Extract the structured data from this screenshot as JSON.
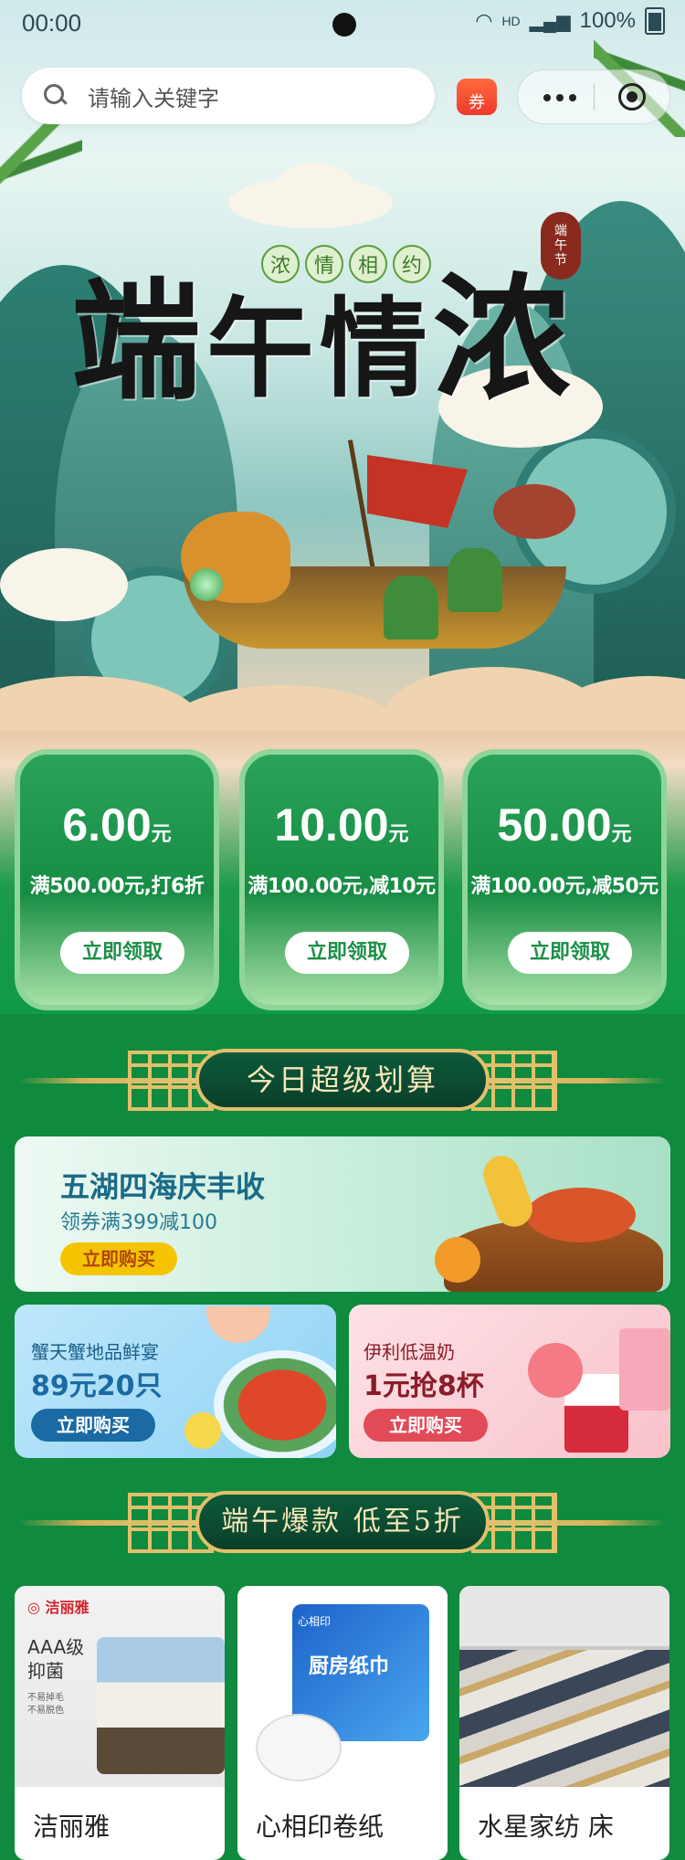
{
  "status_bar": {
    "time": "00:00",
    "network": "HD",
    "battery": "100%"
  },
  "search": {
    "placeholder": "请输入关键字"
  },
  "coupon_icon_label": "券",
  "hero": {
    "title_chars": [
      "端",
      "午",
      "情",
      "浓"
    ],
    "subtitle_chars": [
      "浓",
      "情",
      "相",
      "约"
    ],
    "seal_text": [
      "端",
      "午",
      "节"
    ]
  },
  "coupons": [
    {
      "amount": "6.00",
      "unit": "元",
      "condition": "满500.00元,打6折",
      "button": "立即领取"
    },
    {
      "amount": "10.00",
      "unit": "元",
      "condition": "满100.00元,减10元",
      "button": "立即领取"
    },
    {
      "amount": "50.00",
      "unit": "元",
      "condition": "满100.00元,减50元",
      "button": "立即领取"
    }
  ],
  "section_daily": {
    "title": "今日超级划算"
  },
  "promo_main": {
    "title": "五湖四海庆丰收",
    "subtitle": "领券满399减100",
    "button": "立即购买"
  },
  "promo_crab": {
    "title": "蟹天蟹地品鲜宴",
    "price": "89元20只",
    "button": "立即购买"
  },
  "promo_milk": {
    "title": "伊利低温奶",
    "price": "1元抢8杯",
    "button": "立即购买"
  },
  "section_hot": {
    "title": "端午爆款 低至5折"
  },
  "products": [
    {
      "name": "洁丽雅",
      "brand": "洁丽雅",
      "tagline": "AAA级",
      "tagline2": "抑菌",
      "notes": [
        "不易掉毛",
        "不易脱色"
      ]
    },
    {
      "name": "心相印卷纸",
      "brand": "心相印",
      "tagline": "厨房纸巾"
    },
    {
      "name": "水星家纺 床"
    }
  ],
  "colors": {
    "primary_green": "#109a45",
    "coupon_green": "#2aa35a",
    "gold": "#e2c06b",
    "promo_yellow": "#f5c400",
    "promo_blue": "#1b6aa3",
    "promo_red": "#e24a57"
  }
}
